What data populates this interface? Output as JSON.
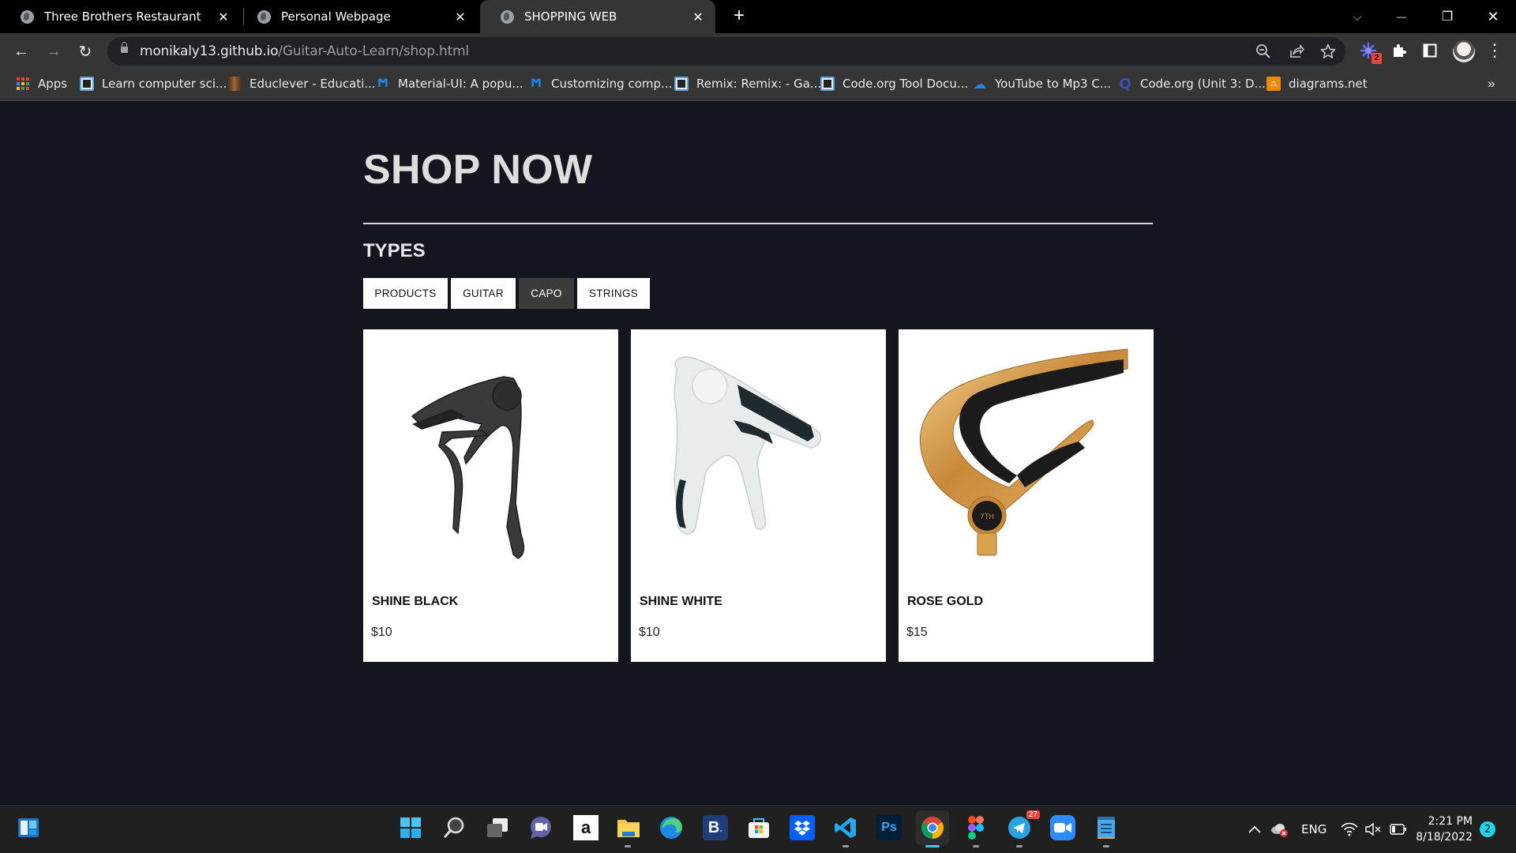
{
  "browser": {
    "tabs": [
      {
        "title": "Three Brothers Restaurant",
        "active": false
      },
      {
        "title": "Personal Webpage",
        "active": false
      },
      {
        "title": "SHOPPING WEB",
        "active": true
      }
    ],
    "tab_close_glyph": "✕",
    "new_tab_glyph": "+",
    "window_controls": {
      "tab_search": "⌵",
      "minimize": "—",
      "restore": "❐",
      "close": "✕"
    },
    "url_host": "monikaly13.github.io",
    "url_path": "/Guitar-Auto-Learn/shop.html",
    "nav": {
      "back": "←",
      "forward": "→",
      "reload": "↻"
    },
    "omnibox_icons": {
      "zoom": "zoom-out-icon",
      "share": "share-icon",
      "bookmark": "star-icon"
    },
    "extension_badge": "2",
    "menu_glyph": "⋮",
    "bookmarks": [
      {
        "label": "Apps",
        "icon": "apps-grid-icon"
      },
      {
        "label": "Learn computer sci...",
        "icon": "code-org-icon"
      },
      {
        "label": "Educlever - Educati...",
        "icon": "educlever-icon"
      },
      {
        "label": "Material-UI: A popu...",
        "icon": "mui-icon"
      },
      {
        "label": "Customizing comp...",
        "icon": "mui-icon"
      },
      {
        "label": "Remix: Remix: - Ga...",
        "icon": "code-org-icon"
      },
      {
        "label": "Code.org Tool Docu...",
        "icon": "code-org-icon"
      },
      {
        "label": "YouTube to Mp3 C...",
        "icon": "download-cloud-icon"
      },
      {
        "label": "Code.org (Unit 3: D...",
        "icon": "quizlet-icon"
      },
      {
        "label": "diagrams.net",
        "icon": "diagrams-icon"
      }
    ],
    "bookmarks_overflow": "»"
  },
  "page": {
    "title": "SHOP NOW",
    "types_heading": "TYPES",
    "filters": [
      {
        "label": "PRODUCTS",
        "active": false
      },
      {
        "label": "GUITAR",
        "active": false
      },
      {
        "label": "CAPO",
        "active": true
      },
      {
        "label": "STRINGS",
        "active": false
      }
    ],
    "products": [
      {
        "name": "SHINE BLACK",
        "price": "$10",
        "image": "black-capo"
      },
      {
        "name": "SHINE WHITE",
        "price": "$10",
        "image": "white-capo"
      },
      {
        "name": "ROSE GOLD",
        "price": "$15",
        "image": "gold-capo"
      }
    ]
  },
  "taskbar": {
    "apps": [
      "widgets",
      "start",
      "search",
      "task-view",
      "teams-chat",
      "amazon",
      "file-explorer",
      "edge",
      "booking",
      "microsoft-store",
      "dropbox",
      "vscode",
      "photoshop",
      "chrome",
      "figma",
      "telegram",
      "zoom",
      "notepad"
    ],
    "telegram_badge": "27",
    "tray": {
      "language": "ENG"
    },
    "time": "2:21 PM",
    "date": "8/18/2022",
    "notification_count": "2"
  },
  "colors": {
    "page_bg": "#13151f",
    "active_filter_bg": "#3b3c37",
    "title_text": "#dddfdf"
  }
}
